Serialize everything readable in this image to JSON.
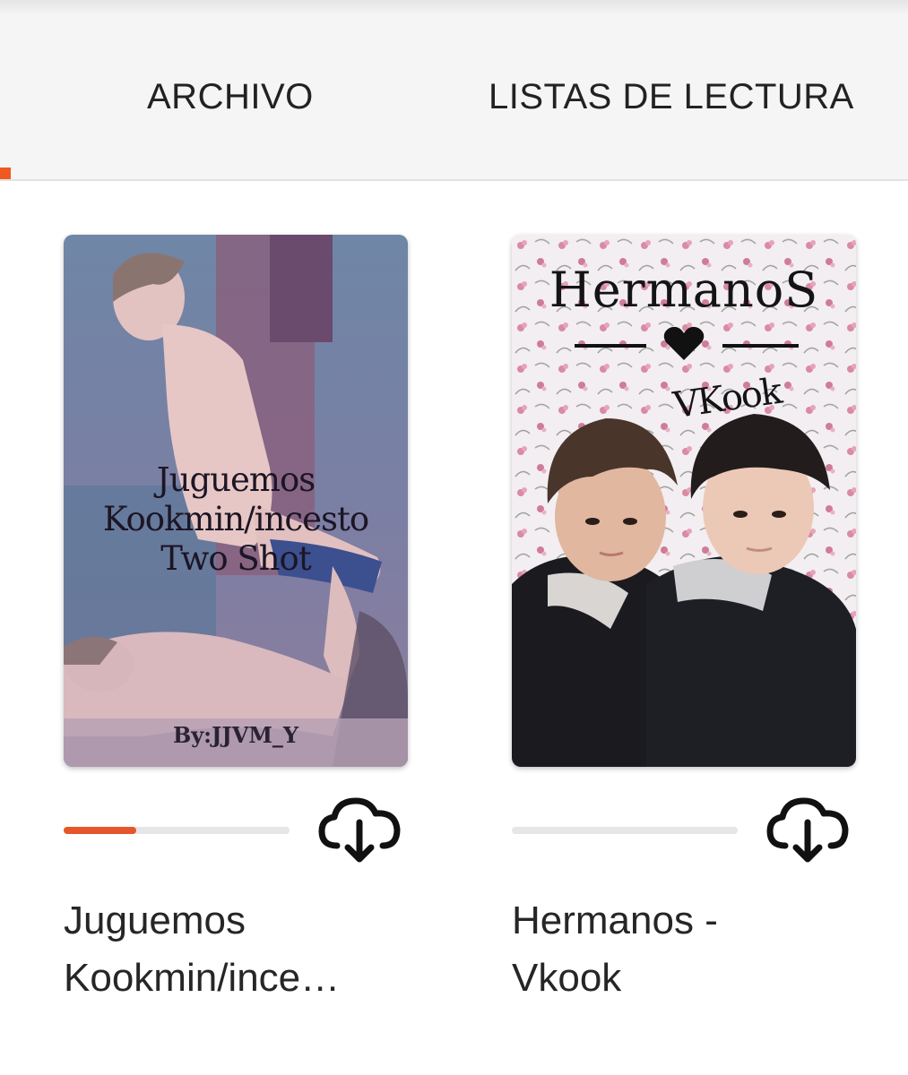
{
  "tabs": [
    {
      "label": "ARCHIVO"
    },
    {
      "label": "LISTAS DE LECTURA"
    }
  ],
  "colors": {
    "accent": "#ee5a1f",
    "track": "#e6e6e6"
  },
  "stories": [
    {
      "cover_lines": [
        "Juguemos",
        "Kookmin/incesto",
        "Two Shot"
      ],
      "cover_author": "By:JJVM_Y",
      "progress": 0.32,
      "title_lines": [
        "Juguemos",
        "Kookmin/ince…"
      ],
      "download_icon": "cloud-download-icon"
    },
    {
      "cover_title": "HermanoS",
      "cover_subtitle": "VKook",
      "progress": 0.0,
      "title_lines": [
        "Hermanos -",
        "Vkook"
      ],
      "download_icon": "cloud-download-icon"
    }
  ]
}
